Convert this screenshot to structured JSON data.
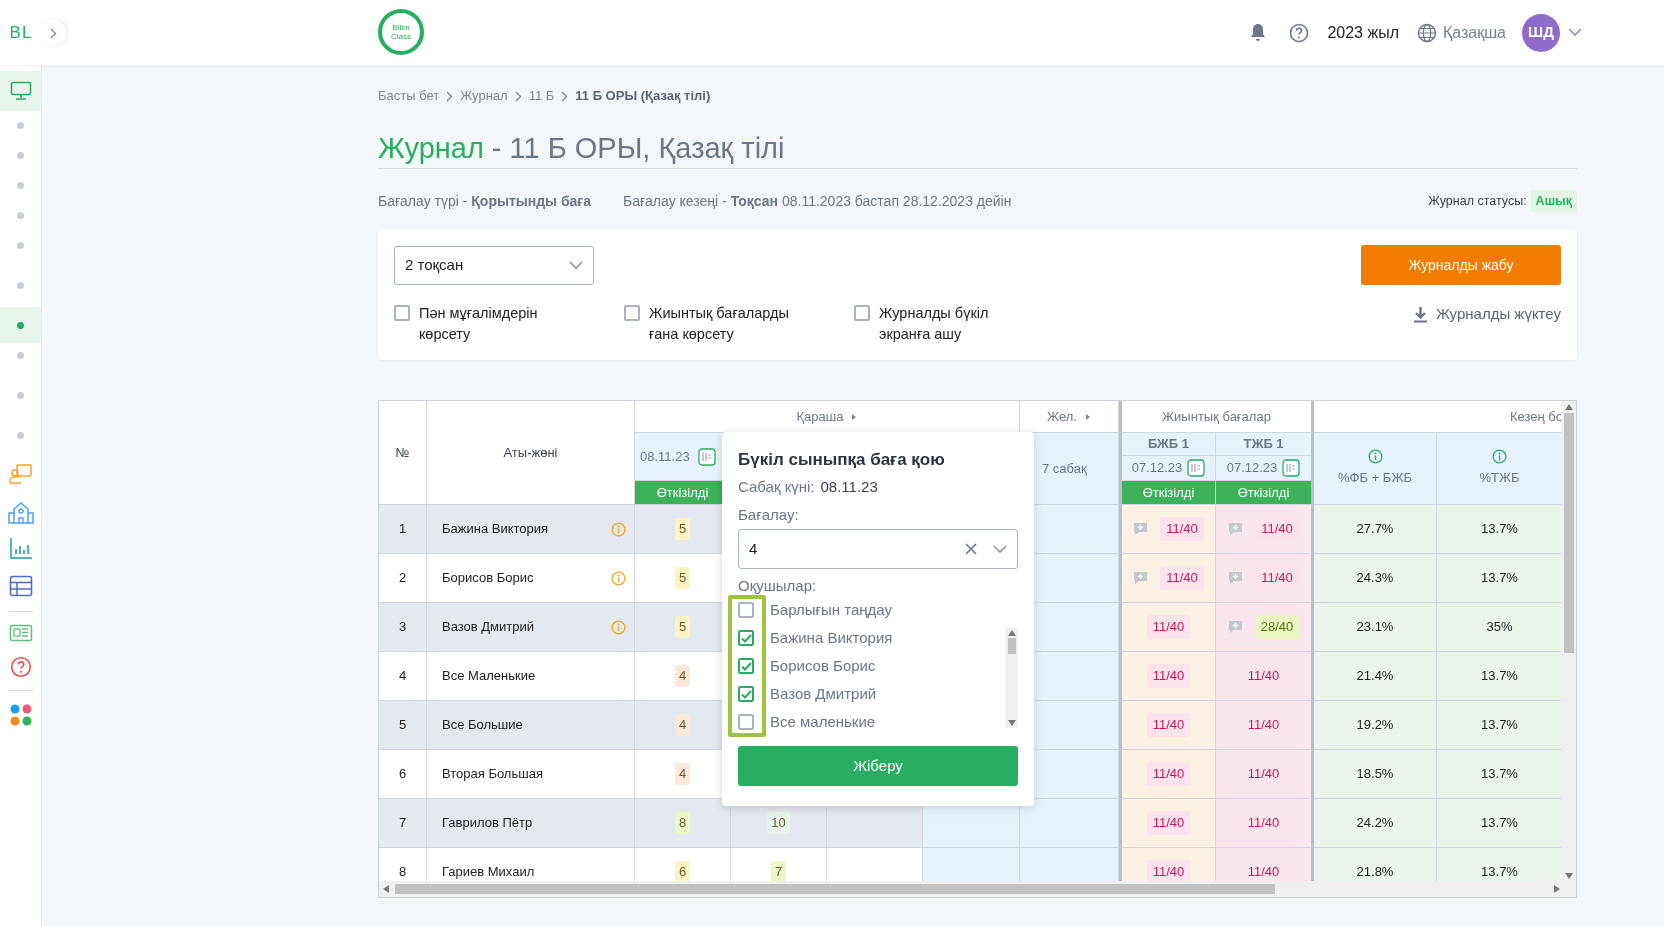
{
  "brand": {
    "short": "BL",
    "logo_line1": "Bilim",
    "logo_line2": "Class"
  },
  "topbar": {
    "year": "2023 жыл",
    "language": "Қазақша",
    "avatar": "ШД"
  },
  "sidebar": {
    "home": {
      "selected": true
    },
    "dots": [
      {
        "selected": false
      },
      {
        "selected": false
      },
      {
        "selected": false
      },
      {
        "selected": false
      },
      {
        "selected": false
      },
      {
        "selected": false
      },
      {
        "selected": true
      },
      {
        "selected": false
      },
      {
        "selected": false
      },
      {
        "selected": false
      }
    ]
  },
  "breadcrumbs": [
    {
      "label": "Басты бет",
      "current": false
    },
    {
      "label": "Журнал",
      "current": false
    },
    {
      "label": "11 Б",
      "current": false
    },
    {
      "label": "11 Б ОРЫ (Қазақ тілі)",
      "current": true
    }
  ],
  "title": {
    "section": "Журнал",
    "rest": "- 11 Б ОРЫ, Қазақ тілі"
  },
  "info": {
    "assessment": "Бағалау түрі - **Қорытынды баға**",
    "period": "Бағалау кезеңі - **Тоқсан** 08.11.2023 бастап 28.12.2023 дейін",
    "status_label": "Журнал статусы:",
    "status_value": "Ашық"
  },
  "controls": {
    "term_select": "2 тоқсан",
    "close_button": "Журналды жабу",
    "download": "Журналды жүктеу",
    "options": [
      {
        "label": "Пән мұғалімдерін көрсету",
        "checked": false
      },
      {
        "label": "Жиынтық бағаларды ғана көрсету",
        "checked": false
      },
      {
        "label": "Журналды бүкіл экранға ашу",
        "checked": false
      }
    ]
  },
  "table": {
    "number_header": "№",
    "name_header": "Аты-жөні",
    "month_1": "Қараша",
    "month_2": "Жел.",
    "lesson_date": "08.11.23",
    "lesson_status": "Өткізілді",
    "month_2_lessons": "7 сабақ",
    "summary_header": "Жиынтық бағалар",
    "period_header": "Кезең бо",
    "summary_columns": [
      {
        "title": "БЖБ 1",
        "date": "07.12.23",
        "status": "Өткізілді"
      },
      {
        "title": "ТЖБ 1",
        "date": "07.12.23",
        "status": "Өткізілді"
      }
    ],
    "percent_columns": [
      "%ФБ + БЖБ",
      "%ТЖБ"
    ],
    "rows": [
      {
        "number": "1",
        "name": "Бажина Виктория",
        "info": true,
        "grades": [
          {
            "value": "5",
            "color": "#fdf3c4"
          }
        ],
        "bjb": {
          "value": "11/40",
          "color": "#fde4ec",
          "comment": true
        },
        "tjb": {
          "value": "11/40",
          "color": "#fde4ec",
          "comment": true
        },
        "percents": [
          "27.7%",
          "13.7%"
        ]
      },
      {
        "number": "2",
        "name": "Борисов Борис",
        "info": true,
        "grades": [
          {
            "value": "5",
            "color": "#fdf3c4"
          }
        ],
        "bjb": {
          "value": "11/40",
          "color": "#fde4ec",
          "comment": true
        },
        "tjb": {
          "value": "11/40",
          "color": "#fde4ec",
          "comment": true
        },
        "percents": [
          "24.3%",
          "13.7%"
        ]
      },
      {
        "number": "3",
        "name": "Вазов Дмитрий",
        "info": true,
        "grades": [
          {
            "value": "5",
            "color": "#fdf3c4"
          }
        ],
        "bjb": {
          "value": "11/40",
          "color": "#fde4ec",
          "comment": false
        },
        "tjb": {
          "value": "28/40",
          "color": "#eaf8c4",
          "comment": true
        },
        "percents": [
          "23.1%",
          "35%"
        ]
      },
      {
        "number": "4",
        "name": "Все Маленькие",
        "info": false,
        "grades": [
          {
            "value": "4",
            "color": "#fde9d9"
          }
        ],
        "bjb": {
          "value": "11/40",
          "color": "#fde4ec",
          "comment": false
        },
        "tjb": {
          "value": "11/40",
          "color": "#fce6ee",
          "comment": false
        },
        "percents": [
          "21.4%",
          "13.7%"
        ]
      },
      {
        "number": "5",
        "name": "Все Большие",
        "info": false,
        "grades": [
          {
            "value": "4",
            "color": "#fde9d9"
          }
        ],
        "bjb": {
          "value": "11/40",
          "color": "#fde4ec",
          "comment": false
        },
        "tjb": {
          "value": "11/40",
          "color": "#fce6ee",
          "comment": false
        },
        "percents": [
          "19.2%",
          "13.7%"
        ]
      },
      {
        "number": "6",
        "name": "Вторая Большая",
        "info": false,
        "grades": [
          {
            "value": "4",
            "color": "#fde9d9"
          }
        ],
        "bjb": {
          "value": "11/40",
          "color": "#fde4ec",
          "comment": false
        },
        "tjb": {
          "value": "11/40",
          "color": "#fce6ee",
          "comment": false
        },
        "percents": [
          "18.5%",
          "13.7%"
        ]
      },
      {
        "number": "7",
        "name": "Гаврилов Пётр",
        "info": false,
        "grades": [
          {
            "value": "8",
            "color": "#eaf8c4"
          },
          {
            "value": "10",
            "color": "#e5f5e9"
          }
        ],
        "bjb": {
          "value": "11/40",
          "color": "#fde4ec",
          "comment": false
        },
        "tjb": {
          "value": "11/40",
          "color": "#fce6ee",
          "comment": false
        },
        "percents": [
          "24.2%",
          "13.7%"
        ]
      },
      {
        "number": "8",
        "name": "Гариев Михаил",
        "info": false,
        "grades": [
          {
            "value": "6",
            "color": "#fdf3c4"
          },
          {
            "value": "7",
            "color": "#eaf8c4"
          }
        ],
        "bjb": {
          "value": "11/40",
          "color": "#fde4ec",
          "comment": false
        },
        "tjb": {
          "value": "11/40",
          "color": "#fce6ee",
          "comment": false
        },
        "percents": [
          "21.8%",
          "13.7%"
        ]
      }
    ]
  },
  "popup": {
    "title": "Бүкіл сыныпқа баға қою",
    "date_label": "Сабақ күні:",
    "date_value": "08.11.23",
    "grade_label": "Бағалау:",
    "grade_value": "4",
    "students_label": "Оқушылар:",
    "students": [
      {
        "label": "Барлығын таңдау",
        "checked": false
      },
      {
        "label": "Бажина Виктория",
        "checked": true
      },
      {
        "label": "Борисов Борис",
        "checked": true
      },
      {
        "label": "Вазов Дмитрий",
        "checked": true
      },
      {
        "label": "Все маленькие",
        "checked": false
      }
    ],
    "submit": "Жіберу"
  }
}
